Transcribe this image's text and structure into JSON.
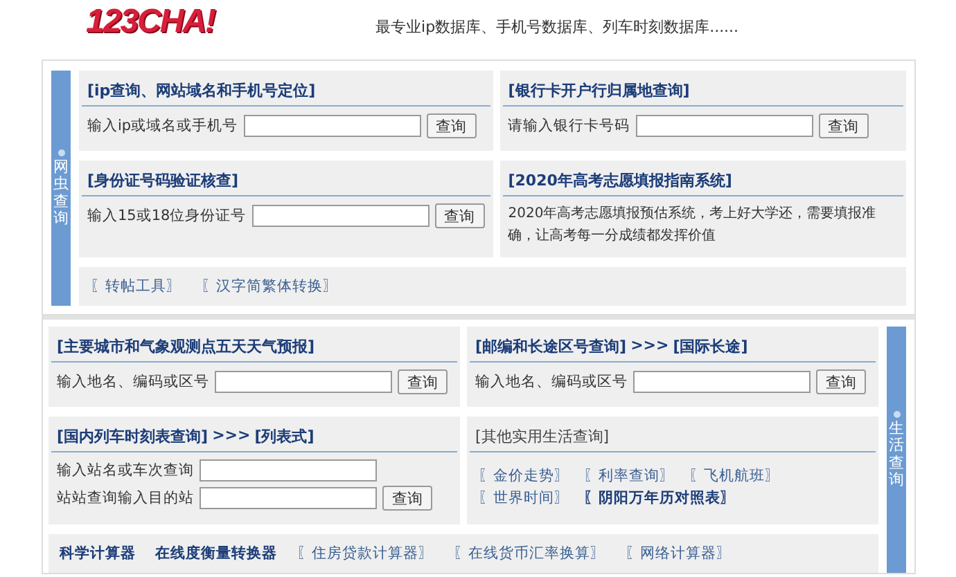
{
  "header": {
    "logo": "123CHA!",
    "tagline": "最专业ip数据库、手机号数据库、列车时刻数据库......"
  },
  "sections": [
    {
      "side_label": "网虫查询",
      "panels": [
        {
          "kind": "form",
          "title_bold": true,
          "title": [
            {
              "kind": "link",
              "text": "[ip查询、网站域名和手机号定位]"
            }
          ],
          "fields": [
            {
              "label": "输入ip或域名或手机号",
              "button": "查询"
            }
          ]
        },
        {
          "kind": "form",
          "title_bold": true,
          "title": [
            {
              "kind": "link",
              "text": "[银行卡开户行归属地查询]"
            }
          ],
          "fields": [
            {
              "label": "请输入银行卡号码",
              "button": "查询"
            }
          ]
        },
        {
          "kind": "form",
          "title_bold": true,
          "title": [
            {
              "kind": "link",
              "text": "[身份证号码验证核查]"
            }
          ],
          "fields": [
            {
              "label": "输入15或18位身份证号",
              "button": "查询"
            }
          ]
        },
        {
          "kind": "text",
          "title_bold": true,
          "title": [
            {
              "kind": "link",
              "text": "[2020年高考志愿填报指南系统]"
            }
          ],
          "text": "2020年高考志愿填报预估系统，考上好大学还，需要填报准确，让高考每一分成绩都发挥价值"
        }
      ],
      "footer_links": [
        {
          "text": "〖转帖工具〗",
          "bold": false
        },
        {
          "text": "〖汉字简繁体转换〗",
          "bold": false
        }
      ]
    },
    {
      "side_label": "生活查询",
      "panels": [
        {
          "kind": "form",
          "title_bold": true,
          "title": [
            {
              "kind": "link",
              "text": "[主要城市和气象观测点五天天气预报]"
            }
          ],
          "fields": [
            {
              "label": "输入地名、编码或区号",
              "button": "查询"
            }
          ]
        },
        {
          "kind": "form",
          "title_bold": true,
          "title": [
            {
              "kind": "link",
              "text": "[邮编和长途区号查询]"
            },
            {
              "kind": "text",
              "text": ">>>"
            },
            {
              "kind": "link",
              "text": "[国际长途]"
            }
          ],
          "fields": [
            {
              "label": "输入地名、编码或区号",
              "button": "查询"
            }
          ]
        },
        {
          "kind": "form",
          "title_bold": true,
          "title": [
            {
              "kind": "link",
              "text": "[国内列车时刻表查询]"
            },
            {
              "kind": "text",
              "text": ">>>"
            },
            {
              "kind": "link",
              "text": "[列表式]"
            }
          ],
          "fields": [
            {
              "label": "输入站名或车次查询"
            },
            {
              "label": "站站查询输入目的站",
              "button": "查询"
            }
          ]
        },
        {
          "kind": "links",
          "title_bold": false,
          "title": [
            {
              "kind": "link",
              "text": "[其他实用生活查询]"
            }
          ],
          "links": [
            {
              "text": "〖金价走势〗",
              "bold": false
            },
            {
              "text": "〖利率查询〗",
              "bold": false
            },
            {
              "text": "〖飞机航班〗",
              "bold": false
            },
            {
              "text": "〖世界时间〗",
              "bold": false
            },
            {
              "text": "〖阴阳万年历对照表〗",
              "bold": true
            }
          ]
        }
      ],
      "footer_links": [
        {
          "text": "科学计算器",
          "bold": true
        },
        {
          "text": "在线度衡量转换器",
          "bold": true
        },
        {
          "text": "〖住房贷款计算器〗",
          "bold": false
        },
        {
          "text": "〖在线货币汇率换算〗",
          "bold": false
        },
        {
          "text": "〖网络计算器〗",
          "bold": false
        }
      ]
    }
  ]
}
